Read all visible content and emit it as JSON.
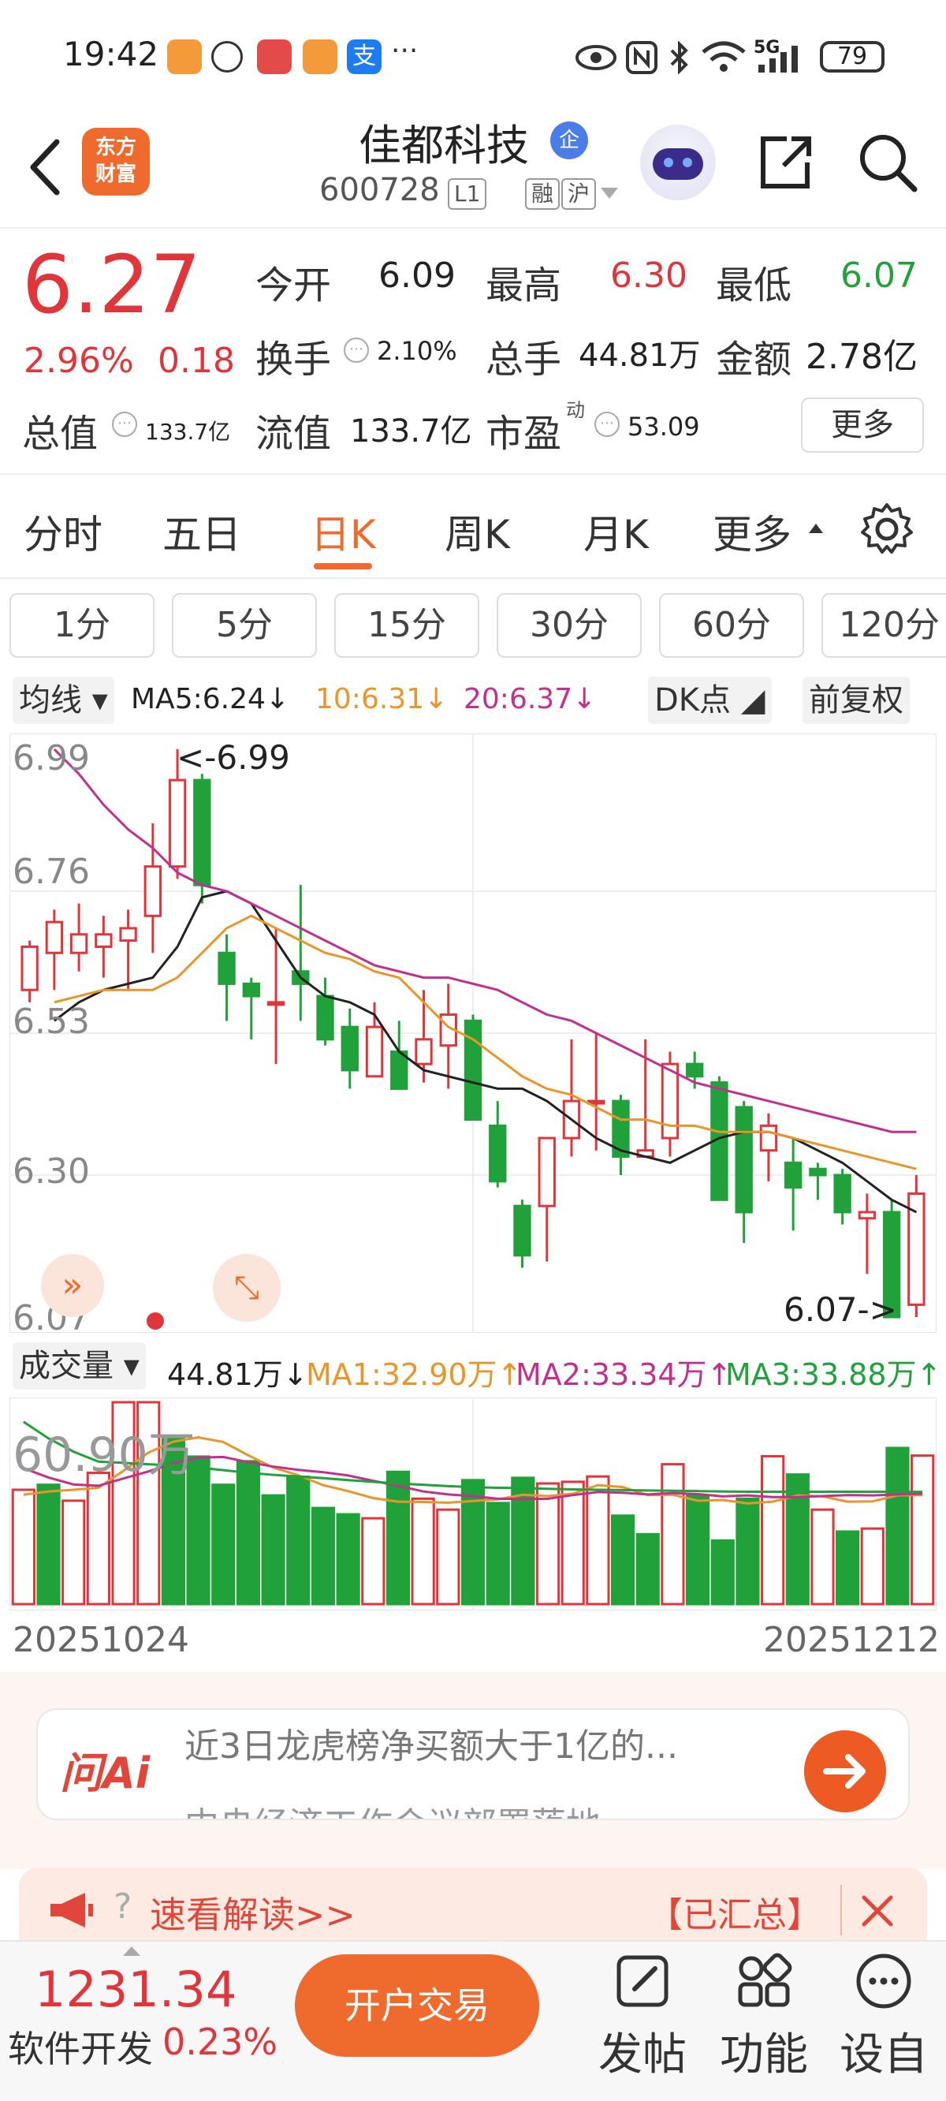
{
  "status_bar": {
    "time": "19:42",
    "more": "···",
    "network": "5G",
    "battery": "79"
  },
  "header": {
    "logo_text": [
      "东方",
      "财富"
    ],
    "stock_name": "佳都科技",
    "badge": "企",
    "code": "600728",
    "tags": [
      "L1",
      "融",
      "沪"
    ]
  },
  "quote": {
    "price": "6.27",
    "change_pct": "2.96%",
    "change": "0.18",
    "open_label": "今开",
    "open": "6.09",
    "high_label": "最高",
    "high": "6.30",
    "low_label": "最低",
    "low": "6.07",
    "turnover_label": "换手",
    "turnover": "2.10%",
    "volume_label": "总手",
    "volume": "44.81万",
    "amount_label": "金额",
    "amount": "2.78亿",
    "mktcap_label": "总值",
    "mktcap": "133.7亿",
    "float_label": "流值",
    "float": "133.7亿",
    "pe_label": "市盈",
    "pe_sup": "动",
    "pe": "53.09",
    "more": "更多"
  },
  "tabs": [
    "分时",
    "五日",
    "日K",
    "周K",
    "月K",
    "更多"
  ],
  "intervals": [
    "1分",
    "5分",
    "15分",
    "30分",
    "60分",
    "120分"
  ],
  "ma_line": {
    "selector": "均线",
    "ma5": "MA5:6.24↓",
    "ma10": "10:6.31↓",
    "ma20": "20:6.37↓",
    "dk": "DK点",
    "adjust": "前复权"
  },
  "colors": {
    "up": "#e0353b",
    "down": "#21a13a",
    "ma5": "#222222",
    "ma10": "#e8962a",
    "ma20": "#c2308f",
    "accent": "#ee6b2d"
  },
  "chart_data": [
    {
      "type": "candlestick",
      "y_ticks": [
        "6.99",
        "6.76",
        "6.53",
        "6.30",
        "6.07"
      ],
      "ylim": [
        6.07,
        6.99
      ],
      "x_range": [
        "20251024",
        "20251212"
      ],
      "max_label": "<-6.99",
      "min_label": "6.07->",
      "series": [
        {
          "name": "MA5",
          "values": [
            6.55,
            6.58,
            6.6,
            6.61,
            6.62,
            6.67,
            6.75,
            6.76,
            6.74,
            6.68,
            6.62,
            6.59,
            6.58,
            6.56,
            6.5,
            6.47,
            6.46,
            6.45,
            6.44,
            6.44,
            6.42,
            6.39,
            6.36,
            6.34,
            6.33,
            6.32,
            6.34,
            6.36,
            6.37,
            6.37,
            6.36,
            6.34,
            6.32,
            6.29,
            6.26,
            6.24
          ]
        },
        {
          "name": "MA10",
          "values": [
            6.58,
            6.59,
            6.6,
            6.6,
            6.6,
            6.62,
            6.66,
            6.7,
            6.72,
            6.7,
            6.68,
            6.66,
            6.65,
            6.63,
            6.62,
            6.58,
            6.54,
            6.52,
            6.49,
            6.46,
            6.44,
            6.43,
            6.41,
            6.39,
            6.39,
            6.38,
            6.38,
            6.37,
            6.37,
            6.37,
            6.36,
            6.35,
            6.34,
            6.33,
            6.32,
            6.31
          ]
        },
        {
          "name": "MA20",
          "values": [
            6.99,
            6.95,
            6.9,
            6.86,
            6.83,
            6.79,
            6.77,
            6.76,
            6.74,
            6.72,
            6.7,
            6.68,
            6.66,
            6.64,
            6.63,
            6.62,
            6.62,
            6.61,
            6.6,
            6.58,
            6.56,
            6.55,
            6.53,
            6.51,
            6.49,
            6.47,
            6.45,
            6.44,
            6.43,
            6.42,
            6.41,
            6.4,
            6.39,
            6.38,
            6.37,
            6.37
          ]
        }
      ],
      "candles": [
        {
          "o": 6.6,
          "h": 6.68,
          "l": 6.58,
          "c": 6.67
        },
        {
          "o": 6.66,
          "h": 6.73,
          "l": 6.6,
          "c": 6.71
        },
        {
          "o": 6.66,
          "h": 6.74,
          "l": 6.63,
          "c": 6.69
        },
        {
          "o": 6.67,
          "h": 6.72,
          "l": 6.62,
          "c": 6.69
        },
        {
          "o": 6.68,
          "h": 6.73,
          "l": 6.6,
          "c": 6.7
        },
        {
          "o": 6.72,
          "h": 6.87,
          "l": 6.66,
          "c": 6.8
        },
        {
          "o": 6.8,
          "h": 6.99,
          "l": 6.78,
          "c": 6.94
        },
        {
          "o": 6.94,
          "h": 6.95,
          "l": 6.74,
          "c": 6.77
        },
        {
          "o": 6.66,
          "h": 6.69,
          "l": 6.55,
          "c": 6.61
        },
        {
          "o": 6.61,
          "h": 6.62,
          "l": 6.52,
          "c": 6.59
        },
        {
          "o": 6.58,
          "h": 6.7,
          "l": 6.48,
          "c": 6.58
        },
        {
          "o": 6.63,
          "h": 6.77,
          "l": 6.55,
          "c": 6.61
        },
        {
          "o": 6.59,
          "h": 6.62,
          "l": 6.51,
          "c": 6.52
        },
        {
          "o": 6.54,
          "h": 6.57,
          "l": 6.44,
          "c": 6.47
        },
        {
          "o": 6.46,
          "h": 6.58,
          "l": 6.46,
          "c": 6.54
        },
        {
          "o": 6.5,
          "h": 6.55,
          "l": 6.44,
          "c": 6.44
        },
        {
          "o": 6.48,
          "h": 6.6,
          "l": 6.45,
          "c": 6.52
        },
        {
          "o": 6.51,
          "h": 6.61,
          "l": 6.44,
          "c": 6.56
        },
        {
          "o": 6.55,
          "h": 6.56,
          "l": 6.39,
          "c": 6.39
        },
        {
          "o": 6.38,
          "h": 6.42,
          "l": 6.28,
          "c": 6.29
        },
        {
          "o": 6.25,
          "h": 6.26,
          "l": 6.15,
          "c": 6.17
        },
        {
          "o": 6.25,
          "h": 6.35,
          "l": 6.16,
          "c": 6.36
        },
        {
          "o": 6.36,
          "h": 6.52,
          "l": 6.33,
          "c": 6.42
        },
        {
          "o": 6.42,
          "h": 6.53,
          "l": 6.34,
          "c": 6.42
        },
        {
          "o": 6.42,
          "h": 6.43,
          "l": 6.3,
          "c": 6.33
        },
        {
          "o": 6.33,
          "h": 6.52,
          "l": 6.33,
          "c": 6.34
        },
        {
          "o": 6.36,
          "h": 6.5,
          "l": 6.33,
          "c": 6.48
        },
        {
          "o": 6.48,
          "h": 6.5,
          "l": 6.44,
          "c": 6.46
        },
        {
          "o": 6.45,
          "h": 6.46,
          "l": 6.26,
          "c": 6.26
        },
        {
          "o": 6.41,
          "h": 6.42,
          "l": 6.19,
          "c": 6.24
        },
        {
          "o": 6.34,
          "h": 6.4,
          "l": 6.29,
          "c": 6.38
        },
        {
          "o": 6.32,
          "h": 6.36,
          "l": 6.21,
          "c": 6.28
        },
        {
          "o": 6.31,
          "h": 6.32,
          "l": 6.26,
          "c": 6.3
        },
        {
          "o": 6.3,
          "h": 6.31,
          "l": 6.22,
          "c": 6.24
        },
        {
          "o": 6.23,
          "h": 6.27,
          "l": 6.14,
          "c": 6.24
        },
        {
          "o": 6.24,
          "h": 6.26,
          "l": 6.07,
          "c": 6.07
        },
        {
          "o": 6.09,
          "h": 6.3,
          "l": 6.07,
          "c": 6.27
        }
      ]
    },
    {
      "type": "bar",
      "title": "成交量",
      "current": "44.81万↓",
      "max_label": "60.90万",
      "ma1": "MA1:32.90万↑",
      "ma2": "MA2:33.34万↑",
      "ma3": "MA3:33.88万↑",
      "ylim": [
        0,
        60.9
      ],
      "values": [
        34.5,
        36,
        31.2,
        39.6,
        60.9,
        60.9,
        49.8,
        44.5,
        36,
        43.1,
        32.8,
        38.4,
        29,
        27.1,
        25.9,
        39.9,
        31.8,
        28.5,
        37.4,
        30.5,
        38.1,
        36.4,
        36.9,
        38.5,
        26.7,
        21.1,
        42.2,
        32.8,
        19.2,
        31.8,
        44.6,
        39.1,
        28.5,
        21.9,
        22.8,
        47.1,
        44.81
      ],
      "up": [
        true,
        false,
        true,
        true,
        true,
        true,
        false,
        false,
        false,
        false,
        false,
        false,
        false,
        false,
        true,
        false,
        true,
        true,
        false,
        false,
        false,
        true,
        true,
        true,
        false,
        false,
        true,
        false,
        false,
        false,
        true,
        false,
        true,
        false,
        true,
        false,
        true
      ],
      "series": [
        {
          "name": "MA1",
          "values": [
            33,
            34,
            34.5,
            35.1,
            40.2,
            45.7,
            49,
            50.3,
            48.9,
            44.9,
            41.2,
            38.9,
            35.9,
            34.1,
            32,
            30.9,
            30.8,
            30.6,
            31.1,
            31.6,
            33,
            32.6,
            33.3,
            35.9,
            35.3,
            32.9,
            33,
            31.2,
            31.4,
            30.4,
            30.9,
            32.8,
            32.5,
            30.9,
            31,
            32.8,
            32.9
          ]
        },
        {
          "name": "MA2",
          "values": [
            41,
            38.2,
            36.1,
            35.7,
            37.9,
            40,
            42.5,
            44.2,
            44.4,
            42.8,
            41.5,
            40.5,
            39.8,
            38.8,
            37.2,
            35.7,
            34,
            33.1,
            32.6,
            31.8,
            31.7,
            31.8,
            32.9,
            33.8,
            33.6,
            33.1,
            33.5,
            33.2,
            32.5,
            32.8,
            32.3,
            32.3,
            32.6,
            32.9,
            32.8,
            33.1,
            33.34
          ]
        },
        {
          "name": "MA3",
          "values": [
            55,
            50,
            46,
            43,
            42.6,
            42.2,
            41.8,
            41.2,
            40.4,
            39.6,
            39,
            38.5,
            38,
            37.4,
            36.9,
            36.4,
            36,
            35.6,
            35.3,
            35.1,
            35,
            34.8,
            34.6,
            34.5,
            34.4,
            34.3,
            34.2,
            34.1,
            34,
            33.9,
            33.9,
            33.9,
            33.9,
            33.9,
            33.9,
            33.88,
            33.88
          ]
        }
      ]
    }
  ],
  "volume_header": {
    "label": "成交量"
  },
  "dates": {
    "start": "20251024",
    "end": "20251212"
  },
  "ask_ai": {
    "logo": "问Ai",
    "line1": "近3日龙虎榜净买额大于1亿的...",
    "line2": "中央经济工作会议部署落地"
  },
  "notice": {
    "q": "?",
    "text": "速看解读>>",
    "tag": "【已汇总】"
  },
  "bottom_bar": {
    "index_value": "1231.34",
    "index_name": "软件开发",
    "index_change": "0.23%",
    "open_account": "开户交易",
    "post": "发帖",
    "functions": "功能",
    "settings": "设自"
  }
}
